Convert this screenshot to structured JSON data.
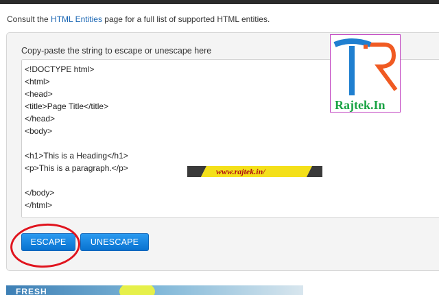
{
  "intro": {
    "before": "Consult the ",
    "link": "HTML Entities",
    "after": " page for a full list of supported HTML entities."
  },
  "tool": {
    "label": "Copy-paste the string to escape or unescape here",
    "input_value": "<!DOCTYPE html>\n<html>\n<head>\n<title>Page Title</title>\n</head>\n<body>\n\n<h1>This is a Heading</h1>\n<p>This is a paragraph.</p>\n\n</body>\n</html>",
    "escape_label": "ESCAPE",
    "unescape_label": "UNESCAPE"
  },
  "watermark": {
    "logo_text": "Rajtek.In",
    "banner_text": "www.rajtek.in/"
  },
  "ad": {
    "text": "FRESH"
  },
  "colors": {
    "button": "#0872d0",
    "link": "#1a66b3",
    "annotation": "#e0141e",
    "logo_blue": "#1f7fd0",
    "logo_orange": "#f05a22",
    "logo_green": "#1aa344",
    "banner_yellow": "#f4e01a"
  }
}
